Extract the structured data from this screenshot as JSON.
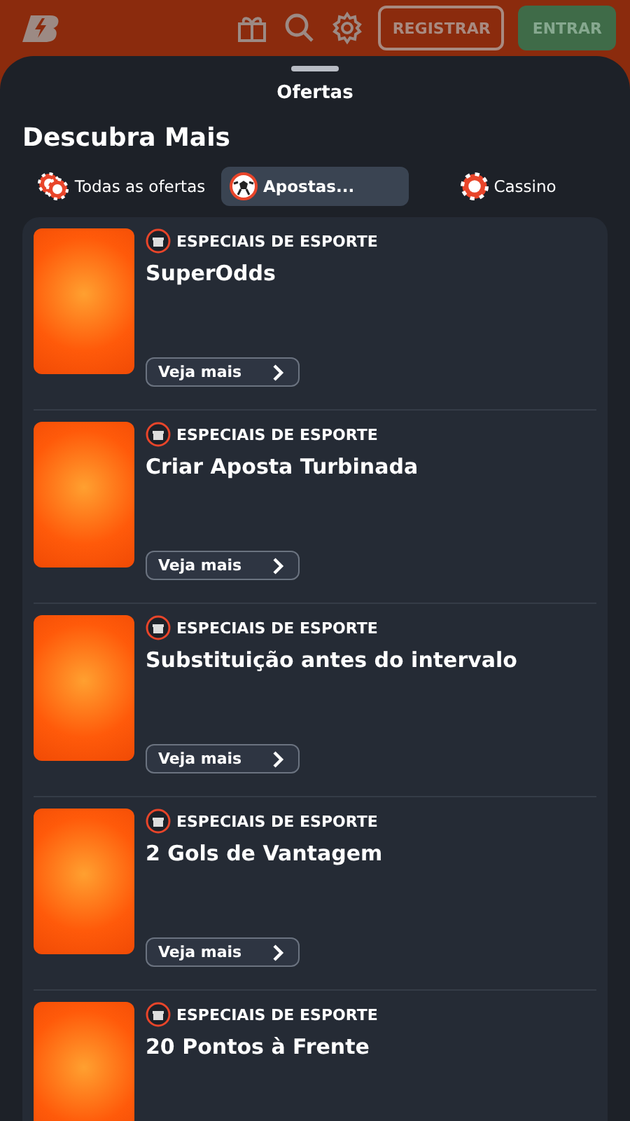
{
  "header": {
    "buttons": [
      {
        "label": "REGISTRAR",
        "kind": "outline"
      },
      {
        "label": "ENTRAR",
        "kind": "filled"
      }
    ]
  },
  "sheet": {
    "title": "Ofertas",
    "heading": "Descubra Mais",
    "tabs": [
      {
        "label": "Todas as ofertas",
        "selected": false,
        "kind": "chips"
      },
      {
        "label": "Apostas...",
        "selected": true,
        "kind": "ball"
      },
      {
        "label": "Cassino",
        "selected": false,
        "kind": "chip"
      }
    ],
    "offers": [
      {
        "category": "ESPECIAIS DE ESPORTE",
        "title": "SuperOdds",
        "button": "Veja mais"
      },
      {
        "category": "ESPECIAIS DE ESPORTE",
        "title": "Criar Aposta Turbinada",
        "button": "Veja mais"
      },
      {
        "category": "ESPECIAIS DE ESPORTE",
        "title": "Substituição antes do intervalo",
        "button": "Veja mais"
      },
      {
        "category": "ESPECIAIS DE ESPORTE",
        "title": "2 Gols de Vantagem",
        "button": "Veja mais"
      },
      {
        "category": "ESPECIAIS DE ESPORTE",
        "title": "20 Pontos à Frente"
      }
    ]
  }
}
